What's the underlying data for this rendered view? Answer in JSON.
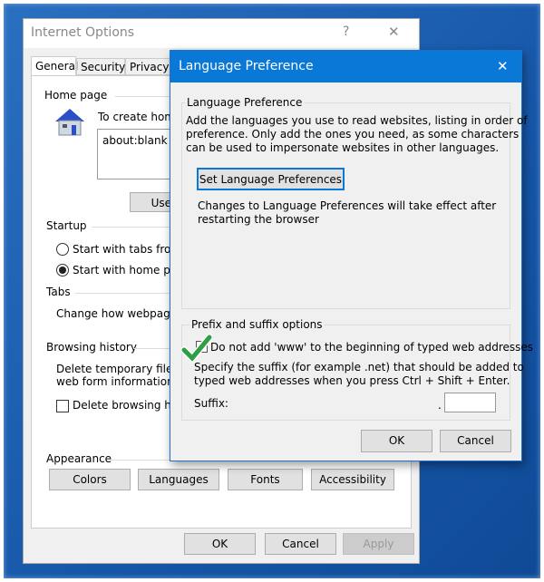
{
  "internet_options": {
    "title": "Internet Options",
    "help": "?",
    "close": "✕",
    "tabs": [
      "General",
      "Security",
      "Privacy"
    ],
    "home_page": {
      "label": "Home page",
      "instruction": "To create home",
      "value": "about:blank",
      "use_current": "Use c"
    },
    "startup": {
      "label": "Startup",
      "option1": "Start with tabs from",
      "option2": "Start with home pag",
      "selected": "option2"
    },
    "tabs_section": {
      "label": "Tabs",
      "text": "Change how webpages"
    },
    "browsing_history": {
      "label": "Browsing history",
      "line1": "Delete temporary files, h",
      "line2": "web form information.",
      "checkbox": "Delete browsing hist",
      "checked": false
    },
    "appearance": {
      "label": "Appearance",
      "buttons": [
        "Colors",
        "Languages",
        "Fonts",
        "Accessibility"
      ]
    },
    "footer": {
      "ok": "OK",
      "cancel": "Cancel",
      "apply": "Apply"
    }
  },
  "language_dialog": {
    "title": "Language Preference",
    "close": "✕",
    "group1": {
      "label": "Language Preference",
      "desc": [
        "Add the languages you use to read websites, listing in order of",
        "preference. Only add the ones you need, as some characters",
        "can be used to impersonate websites in other languages."
      ],
      "button": "Set Language Preferences",
      "note": [
        "Changes to Language Preferences will take effect after",
        "restarting the browser"
      ]
    },
    "group2": {
      "label": "Prefix and suffix options",
      "checkbox": "Do not add 'www' to the beginning of typed web addresses",
      "checked": false,
      "desc": [
        "Specify the suffix (for example .net) that should be added to",
        "typed web addresses when you press Ctrl + Shift + Enter."
      ],
      "suffix_label": "Suffix:",
      "dot": ".",
      "suffix_value": ""
    },
    "ok": "OK",
    "cancel": "Cancel"
  },
  "colors": {
    "accent": "#0a78d7",
    "checkmark": "#2ea043"
  }
}
